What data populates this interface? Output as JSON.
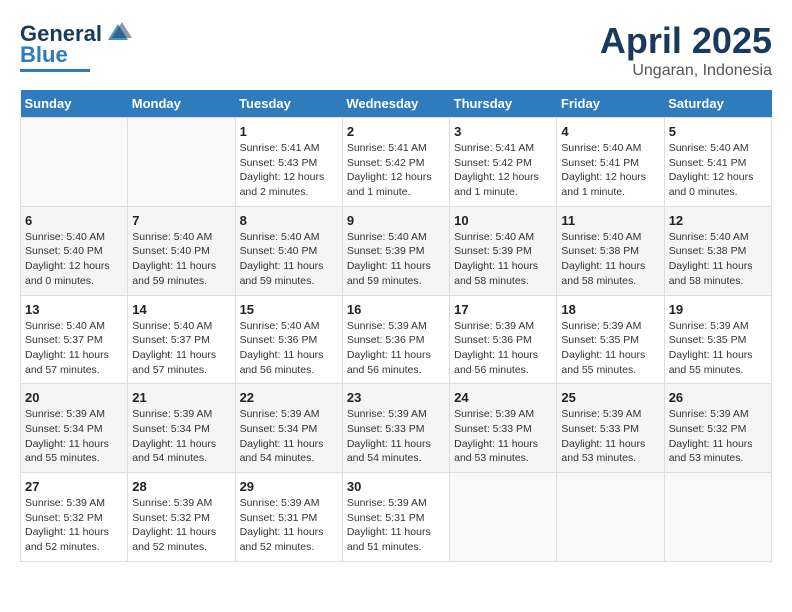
{
  "logo": {
    "general": "General",
    "blue": "Blue"
  },
  "title": "April 2025",
  "subtitle": "Ungaran, Indonesia",
  "days_header": [
    "Sunday",
    "Monday",
    "Tuesday",
    "Wednesday",
    "Thursday",
    "Friday",
    "Saturday"
  ],
  "weeks": [
    [
      {
        "day": "",
        "info": ""
      },
      {
        "day": "",
        "info": ""
      },
      {
        "day": "1",
        "info": "Sunrise: 5:41 AM\nSunset: 5:43 PM\nDaylight: 12 hours\nand 2 minutes."
      },
      {
        "day": "2",
        "info": "Sunrise: 5:41 AM\nSunset: 5:42 PM\nDaylight: 12 hours\nand 1 minute."
      },
      {
        "day": "3",
        "info": "Sunrise: 5:41 AM\nSunset: 5:42 PM\nDaylight: 12 hours\nand 1 minute."
      },
      {
        "day": "4",
        "info": "Sunrise: 5:40 AM\nSunset: 5:41 PM\nDaylight: 12 hours\nand 1 minute."
      },
      {
        "day": "5",
        "info": "Sunrise: 5:40 AM\nSunset: 5:41 PM\nDaylight: 12 hours\nand 0 minutes."
      }
    ],
    [
      {
        "day": "6",
        "info": "Sunrise: 5:40 AM\nSunset: 5:40 PM\nDaylight: 12 hours\nand 0 minutes."
      },
      {
        "day": "7",
        "info": "Sunrise: 5:40 AM\nSunset: 5:40 PM\nDaylight: 11 hours\nand 59 minutes."
      },
      {
        "day": "8",
        "info": "Sunrise: 5:40 AM\nSunset: 5:40 PM\nDaylight: 11 hours\nand 59 minutes."
      },
      {
        "day": "9",
        "info": "Sunrise: 5:40 AM\nSunset: 5:39 PM\nDaylight: 11 hours\nand 59 minutes."
      },
      {
        "day": "10",
        "info": "Sunrise: 5:40 AM\nSunset: 5:39 PM\nDaylight: 11 hours\nand 58 minutes."
      },
      {
        "day": "11",
        "info": "Sunrise: 5:40 AM\nSunset: 5:38 PM\nDaylight: 11 hours\nand 58 minutes."
      },
      {
        "day": "12",
        "info": "Sunrise: 5:40 AM\nSunset: 5:38 PM\nDaylight: 11 hours\nand 58 minutes."
      }
    ],
    [
      {
        "day": "13",
        "info": "Sunrise: 5:40 AM\nSunset: 5:37 PM\nDaylight: 11 hours\nand 57 minutes."
      },
      {
        "day": "14",
        "info": "Sunrise: 5:40 AM\nSunset: 5:37 PM\nDaylight: 11 hours\nand 57 minutes."
      },
      {
        "day": "15",
        "info": "Sunrise: 5:40 AM\nSunset: 5:36 PM\nDaylight: 11 hours\nand 56 minutes."
      },
      {
        "day": "16",
        "info": "Sunrise: 5:39 AM\nSunset: 5:36 PM\nDaylight: 11 hours\nand 56 minutes."
      },
      {
        "day": "17",
        "info": "Sunrise: 5:39 AM\nSunset: 5:36 PM\nDaylight: 11 hours\nand 56 minutes."
      },
      {
        "day": "18",
        "info": "Sunrise: 5:39 AM\nSunset: 5:35 PM\nDaylight: 11 hours\nand 55 minutes."
      },
      {
        "day": "19",
        "info": "Sunrise: 5:39 AM\nSunset: 5:35 PM\nDaylight: 11 hours\nand 55 minutes."
      }
    ],
    [
      {
        "day": "20",
        "info": "Sunrise: 5:39 AM\nSunset: 5:34 PM\nDaylight: 11 hours\nand 55 minutes."
      },
      {
        "day": "21",
        "info": "Sunrise: 5:39 AM\nSunset: 5:34 PM\nDaylight: 11 hours\nand 54 minutes."
      },
      {
        "day": "22",
        "info": "Sunrise: 5:39 AM\nSunset: 5:34 PM\nDaylight: 11 hours\nand 54 minutes."
      },
      {
        "day": "23",
        "info": "Sunrise: 5:39 AM\nSunset: 5:33 PM\nDaylight: 11 hours\nand 54 minutes."
      },
      {
        "day": "24",
        "info": "Sunrise: 5:39 AM\nSunset: 5:33 PM\nDaylight: 11 hours\nand 53 minutes."
      },
      {
        "day": "25",
        "info": "Sunrise: 5:39 AM\nSunset: 5:33 PM\nDaylight: 11 hours\nand 53 minutes."
      },
      {
        "day": "26",
        "info": "Sunrise: 5:39 AM\nSunset: 5:32 PM\nDaylight: 11 hours\nand 53 minutes."
      }
    ],
    [
      {
        "day": "27",
        "info": "Sunrise: 5:39 AM\nSunset: 5:32 PM\nDaylight: 11 hours\nand 52 minutes."
      },
      {
        "day": "28",
        "info": "Sunrise: 5:39 AM\nSunset: 5:32 PM\nDaylight: 11 hours\nand 52 minutes."
      },
      {
        "day": "29",
        "info": "Sunrise: 5:39 AM\nSunset: 5:31 PM\nDaylight: 11 hours\nand 52 minutes."
      },
      {
        "day": "30",
        "info": "Sunrise: 5:39 AM\nSunset: 5:31 PM\nDaylight: 11 hours\nand 51 minutes."
      },
      {
        "day": "",
        "info": ""
      },
      {
        "day": "",
        "info": ""
      },
      {
        "day": "",
        "info": ""
      }
    ]
  ]
}
